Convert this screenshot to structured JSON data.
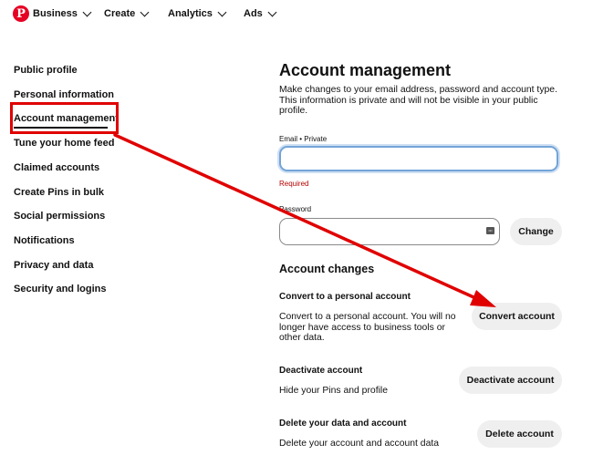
{
  "nav": {
    "logo_letter": "P",
    "items": [
      {
        "label": "Business"
      },
      {
        "label": "Create"
      },
      {
        "label": "Analytics"
      },
      {
        "label": "Ads"
      }
    ]
  },
  "sidebar": {
    "items": [
      {
        "label": "Public profile"
      },
      {
        "label": "Personal information"
      },
      {
        "label": "Account management",
        "active": true
      },
      {
        "label": "Tune your home feed"
      },
      {
        "label": "Claimed accounts"
      },
      {
        "label": "Create Pins in bulk"
      },
      {
        "label": "Social permissions"
      },
      {
        "label": "Notifications"
      },
      {
        "label": "Privacy and data"
      },
      {
        "label": "Security and logins"
      }
    ]
  },
  "main": {
    "title": "Account management",
    "description": "Make changes to your email address, password and account type. This information is private and will not be visible in your public profile.",
    "email": {
      "label": "Email • Private",
      "value": "",
      "required_text": "Required"
    },
    "password": {
      "label": "Password",
      "value": "",
      "change_label": "Change"
    },
    "changes_title": "Account changes",
    "convert": {
      "title": "Convert to a personal account",
      "text": "Convert to a personal account. You will no longer have access to business tools or other data.",
      "button": "Convert account"
    },
    "deactivate": {
      "title": "Deactivate account",
      "text": "Hide your Pins and profile",
      "button": "Deactivate account"
    },
    "delete": {
      "title": "Delete your data and account",
      "text": "Delete your account and account data",
      "button": "Delete account"
    }
  },
  "annotation": {
    "color": "#e00000"
  }
}
